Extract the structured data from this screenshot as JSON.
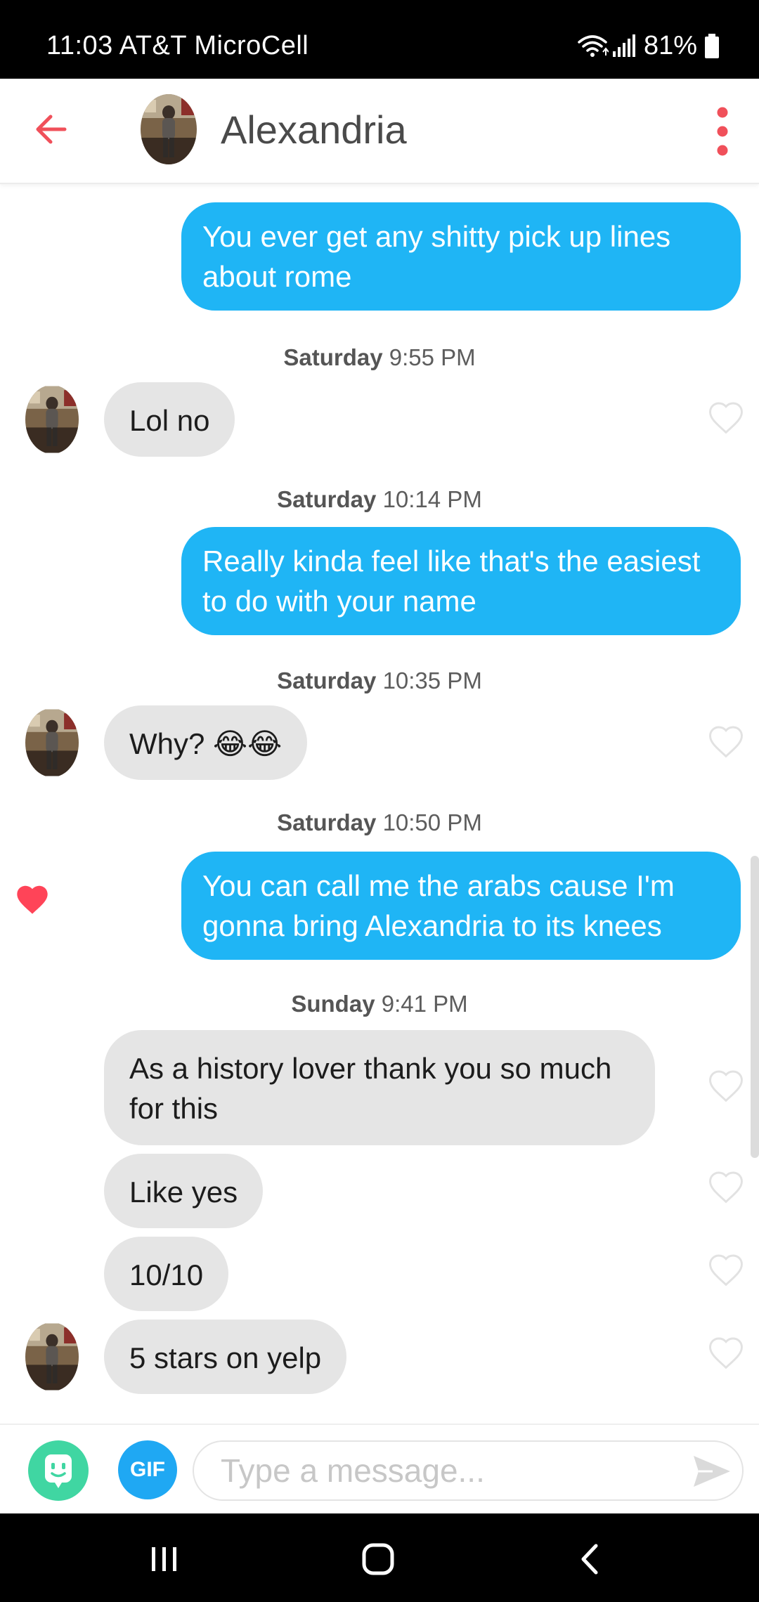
{
  "status_bar": {
    "time_carrier": "11:03 AT&T MicroCell",
    "battery_text": "81%"
  },
  "header": {
    "contact_name": "Alexandria"
  },
  "messages": [
    {
      "side": "out",
      "text": "You ever get any shitty pick up lines about rome"
    },
    {
      "day": "Saturday",
      "time": "9:55 PM"
    },
    {
      "side": "in",
      "text": "Lol no"
    },
    {
      "day": "Saturday",
      "time": "10:14 PM"
    },
    {
      "side": "out",
      "text": "Really kinda feel like that's the easiest to do with your name"
    },
    {
      "day": "Saturday",
      "time": "10:35 PM"
    },
    {
      "side": "in",
      "text": "Why? 😂😂"
    },
    {
      "day": "Saturday",
      "time": "10:50 PM"
    },
    {
      "side": "out",
      "text": "You can call me the arabs cause I'm gonna bring Alexandria to its knees",
      "liked": true
    },
    {
      "day": "Sunday",
      "time": "9:41 PM"
    },
    {
      "side": "in",
      "text": "As a history lover thank you so much for this"
    },
    {
      "side": "in",
      "text": "Like yes"
    },
    {
      "side": "in",
      "text": "10/10"
    },
    {
      "side": "in",
      "text": "5 stars on yelp"
    }
  ],
  "composer": {
    "gif_label": "GIF",
    "placeholder": "Type a message..."
  },
  "colors": {
    "outgoing_bubble": "#1fb5f5",
    "incoming_bubble": "#e5e5e5",
    "accent_red": "#ff4458",
    "sticker_green": "#40d6a2"
  }
}
